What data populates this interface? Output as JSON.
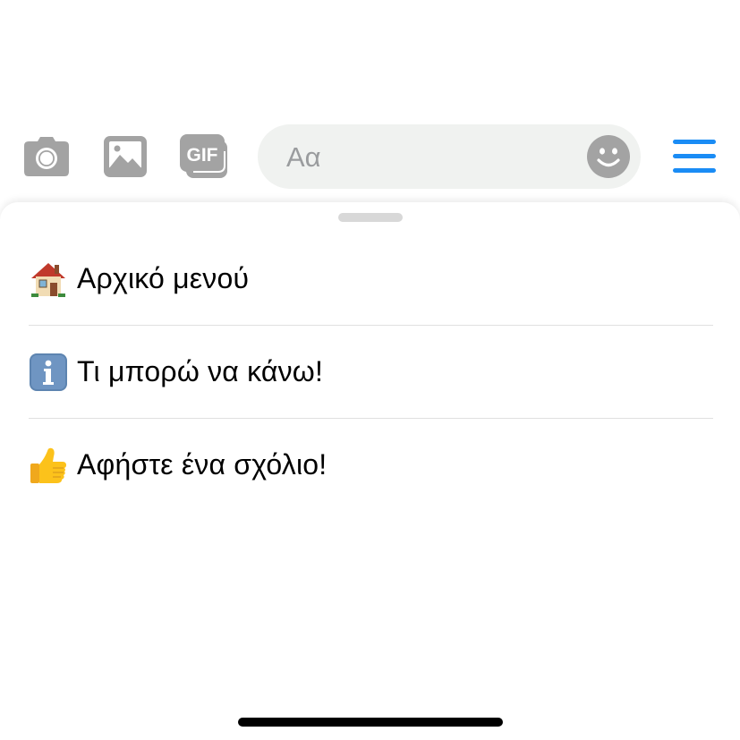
{
  "composer": {
    "camera_icon": "camera-icon",
    "photo_icon": "photo-icon",
    "gif_icon": "gif-icon",
    "gif_text": "GIF",
    "input_placeholder": "Aα",
    "input_value": "",
    "emoji_icon": "smiley-icon",
    "menu_icon": "hamburger-menu-icon",
    "icon_color": "#a3a3a3",
    "accent_color": "#1a8cf5"
  },
  "sheet": {
    "items": [
      {
        "emoji": "🏠",
        "label": "Αρχικό μενού"
      },
      {
        "emoji": "ℹ️",
        "label": "Τι μπορώ να κάνω!"
      },
      {
        "emoji": "👍",
        "label": "Αφήστε ένα σχόλιο!"
      }
    ]
  }
}
